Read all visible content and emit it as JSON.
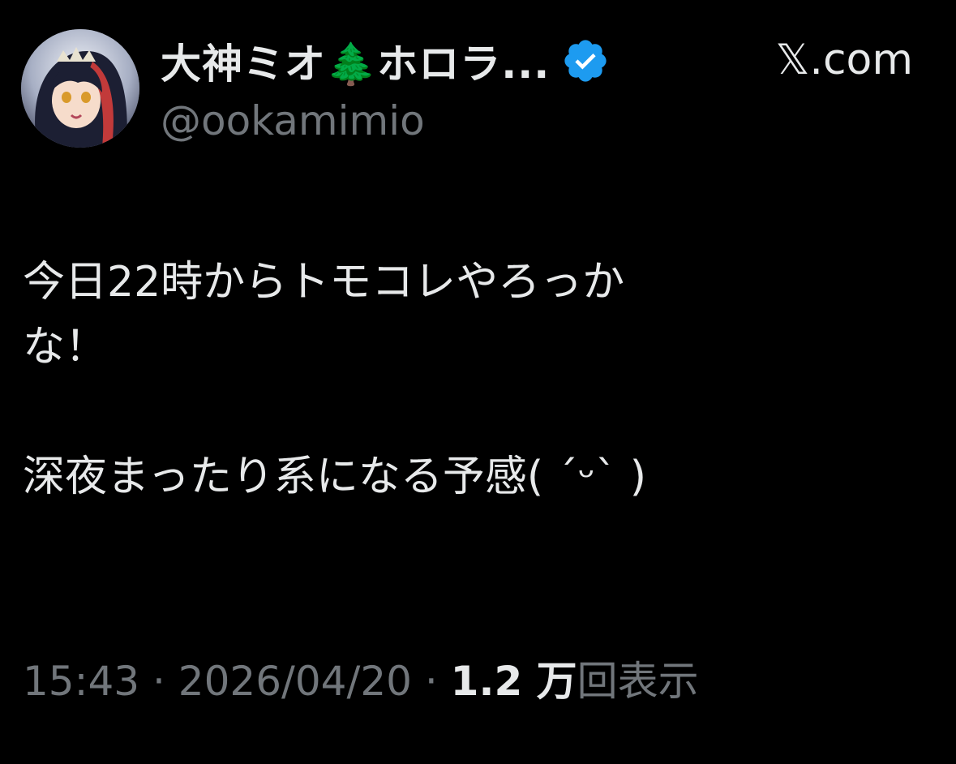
{
  "site_label": "𝕏.com",
  "author": {
    "display_name": "大神ミオ🌲ホロラ...",
    "handle": "@ookamimio",
    "verified": true
  },
  "tweet": {
    "line1": "今日22時からトモコレやろっか",
    "line2": "な！",
    "line3": "深夜まったり系になる予感( ´ᵕ` )"
  },
  "meta": {
    "time": "15:43",
    "separator1": " · ",
    "date": "2026/04/20",
    "separator2": " · ",
    "views_count": "1.2 万",
    "views_label": "回表示"
  },
  "colors": {
    "background": "#000000",
    "primary_text": "#e7e9ea",
    "secondary_text": "#71767b",
    "verified_badge": "#1d9bf0"
  },
  "icons": {
    "verified": "verified-badge-icon",
    "avatar": "avatar-image"
  }
}
